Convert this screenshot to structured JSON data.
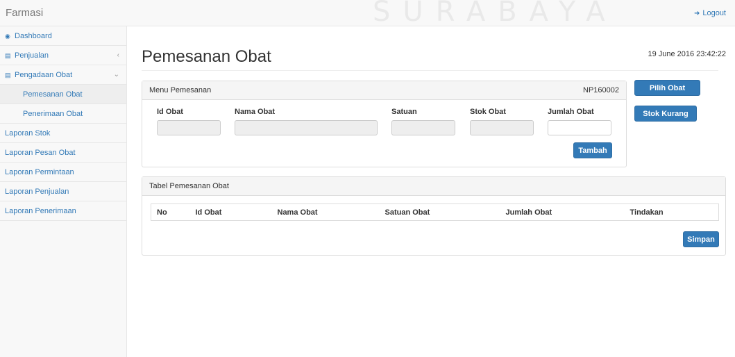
{
  "app": {
    "brand": "Farmasi",
    "watermark": "SURABAYA",
    "logout_label": "Logout",
    "accent": "#337ab7"
  },
  "sidebar": {
    "items": [
      {
        "label": "Dashboard",
        "icon": "dashboard-icon"
      },
      {
        "label": "Penjualan",
        "icon": "bar-chart-icon"
      },
      {
        "label": "Pengadaan Obat",
        "icon": "bar-chart-icon"
      },
      {
        "label": "Pemesanan Obat"
      },
      {
        "label": "Penerimaan Obat"
      },
      {
        "label": "Laporan Stok"
      },
      {
        "label": "Laporan Pesan Obat"
      },
      {
        "label": "Laporan Permintaan"
      },
      {
        "label": "Laporan Penjualan"
      },
      {
        "label": "Laporan Penerimaan"
      }
    ]
  },
  "main": {
    "title": "Pemesanan Obat",
    "datetime": "19 June 2016 23:42:22",
    "menu_panel": {
      "title": "Menu Pemesanan",
      "order_code": "NP160002",
      "fields": [
        {
          "label": "Id Obat",
          "value": ""
        },
        {
          "label": "Nama Obat",
          "value": ""
        },
        {
          "label": "Satuan",
          "value": ""
        },
        {
          "label": "Stok Obat",
          "value": ""
        },
        {
          "label": "Jumlah Obat",
          "value": ""
        }
      ],
      "add_button": "Tambah"
    },
    "side_buttons": {
      "pick": "Pilih Obat",
      "low_stock": "Stok Kurang"
    },
    "table_panel": {
      "title": "Tabel Pemesanan Obat",
      "columns": [
        "No",
        "Id Obat",
        "Nama Obat",
        "Satuan Obat",
        "Jumlah Obat",
        "Tindakan"
      ],
      "save_button": "Simpan"
    }
  }
}
